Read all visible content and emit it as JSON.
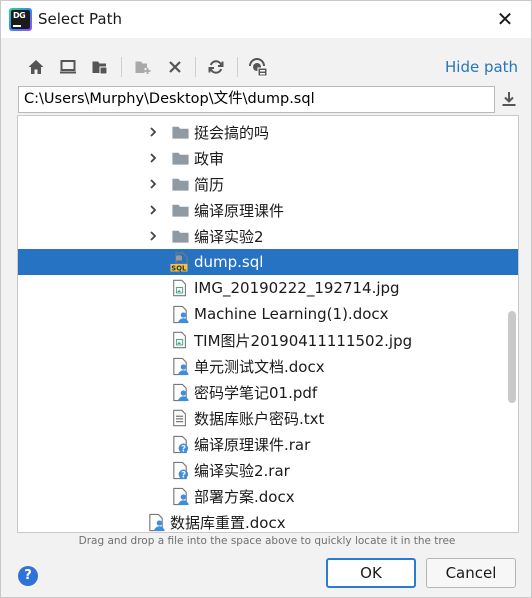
{
  "dialog": {
    "title": "Select Path",
    "close_glyph": "✕",
    "app_icon": {
      "label": "DG"
    }
  },
  "toolbar": {
    "buttons": [
      {
        "icon": "home-icon"
      },
      {
        "icon": "desktop-icon"
      },
      {
        "icon": "project-folder-icon"
      },
      {
        "icon": "new-folder-icon"
      },
      {
        "icon": "delete-icon"
      },
      {
        "icon": "refresh-icon"
      },
      {
        "icon": "show-hidden-icon"
      }
    ],
    "hide_path_label": "Hide path"
  },
  "path_field": {
    "value": "C:\\Users\\Murphy\\Desktop\\文件\\dump.sql"
  },
  "tree": {
    "items": [
      {
        "label": "挺会搞的吗",
        "type": "folder",
        "expandable": true,
        "selected": false
      },
      {
        "label": "政审",
        "type": "folder",
        "expandable": true,
        "selected": false
      },
      {
        "label": "简历",
        "type": "folder",
        "expandable": true,
        "selected": false
      },
      {
        "label": "编译原理课件",
        "type": "folder",
        "expandable": true,
        "selected": false
      },
      {
        "label": "编译实验2",
        "type": "folder",
        "expandable": true,
        "selected": false
      },
      {
        "label": "dump.sql",
        "type": "sql",
        "expandable": false,
        "selected": true
      },
      {
        "label": "IMG_20190222_192714.jpg",
        "type": "image",
        "expandable": false,
        "selected": false
      },
      {
        "label": "Machine Learning(1).docx",
        "type": "unknown-user",
        "expandable": false,
        "selected": false
      },
      {
        "label": "TIM图片20190411111502.jpg",
        "type": "image",
        "expandable": false,
        "selected": false
      },
      {
        "label": "单元测试文档.docx",
        "type": "unknown-user",
        "expandable": false,
        "selected": false
      },
      {
        "label": "密码学笔记01.pdf",
        "type": "unknown-user",
        "expandable": false,
        "selected": false
      },
      {
        "label": "数据库账户密码.txt",
        "type": "text",
        "expandable": false,
        "selected": false
      },
      {
        "label": "编译原理课件.rar",
        "type": "unknown-question",
        "expandable": false,
        "selected": false
      },
      {
        "label": "编译实验2.rar",
        "type": "unknown-question",
        "expandable": false,
        "selected": false
      },
      {
        "label": "部署方案.docx",
        "type": "unknown-user",
        "expandable": false,
        "selected": false
      },
      {
        "label": "数据库重置.docx",
        "type": "unknown-user",
        "expandable": false,
        "selected": false
      }
    ]
  },
  "hint": "Drag and drop a file into the space above to quickly locate it in the tree",
  "footer": {
    "help_glyph": "?",
    "ok_label": "OK",
    "cancel_label": "Cancel"
  },
  "colors": {
    "selection": "#2673c4",
    "link": "#2675bf",
    "ok_border": "#2a7bd1"
  }
}
